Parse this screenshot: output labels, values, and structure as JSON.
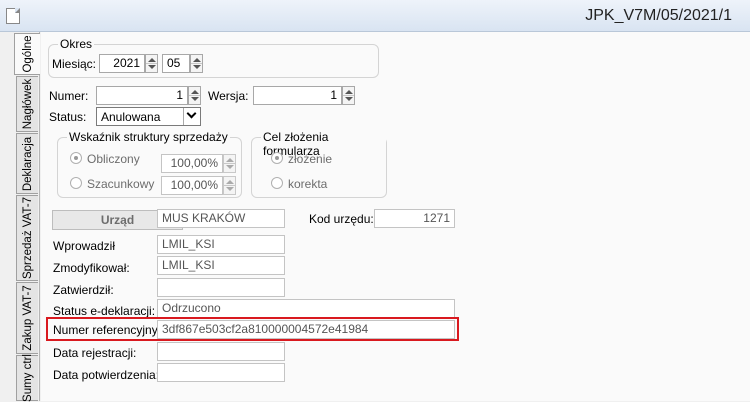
{
  "window": {
    "title": "JPK_V7M/05/2021/1"
  },
  "tabs": [
    {
      "label": "Ogólne",
      "active": true
    },
    {
      "label": "Nagłówek"
    },
    {
      "label": "Deklaracja"
    },
    {
      "label": "Sprzedaż VAT-7"
    },
    {
      "label": "Zakup VAT-7"
    },
    {
      "label": "Sumy ctrl"
    }
  ],
  "okres": {
    "legend": "Okres",
    "miesiac_label": "Miesiąc:",
    "year": "2021",
    "month": "05"
  },
  "numer": {
    "label": "Numer:",
    "value": "1"
  },
  "wersja": {
    "label": "Wersja:",
    "value": "1"
  },
  "status": {
    "label": "Status:",
    "value": "Anulowana"
  },
  "wskaznik": {
    "legend": "Wskaźnik struktury sprzedaży",
    "obliczony_label": "Obliczony",
    "obliczony_value": "100,00%",
    "szacunkowy_label": "Szacunkowy",
    "szacunkowy_value": "100,00%"
  },
  "cel": {
    "legend": "Cel złożenia formularza",
    "zlozenie_label": "złożenie",
    "korekta_label": "korekta"
  },
  "urzad": {
    "button_label": "Urząd",
    "name": "MUS KRAKÓW",
    "kod_label": "Kod urzędu:",
    "kod_value": "1271"
  },
  "info": {
    "wprowadzil_label": "Wprowadził",
    "wprowadzil_value": "LMIL_KSI",
    "zmodyfikowal_label": "Zmodyfikował:",
    "zmodyfikowal_value": "LMIL_KSI",
    "zatwierdzil_label": "Zatwierdził:",
    "zatwierdzil_value": "",
    "status_edekl_label": "Status e-deklaracji:",
    "status_edekl_value": "Odrzucono",
    "numer_ref_label": "Numer referencyjny",
    "numer_ref_value": "3df867e503cf2a810000004572e41984",
    "data_rej_label": "Data rejestracji:",
    "data_rej_value": "",
    "data_potw_label": "Data potwierdzenia:",
    "data_potw_value": ""
  },
  "colors": {
    "highlight": "#d9191f"
  }
}
